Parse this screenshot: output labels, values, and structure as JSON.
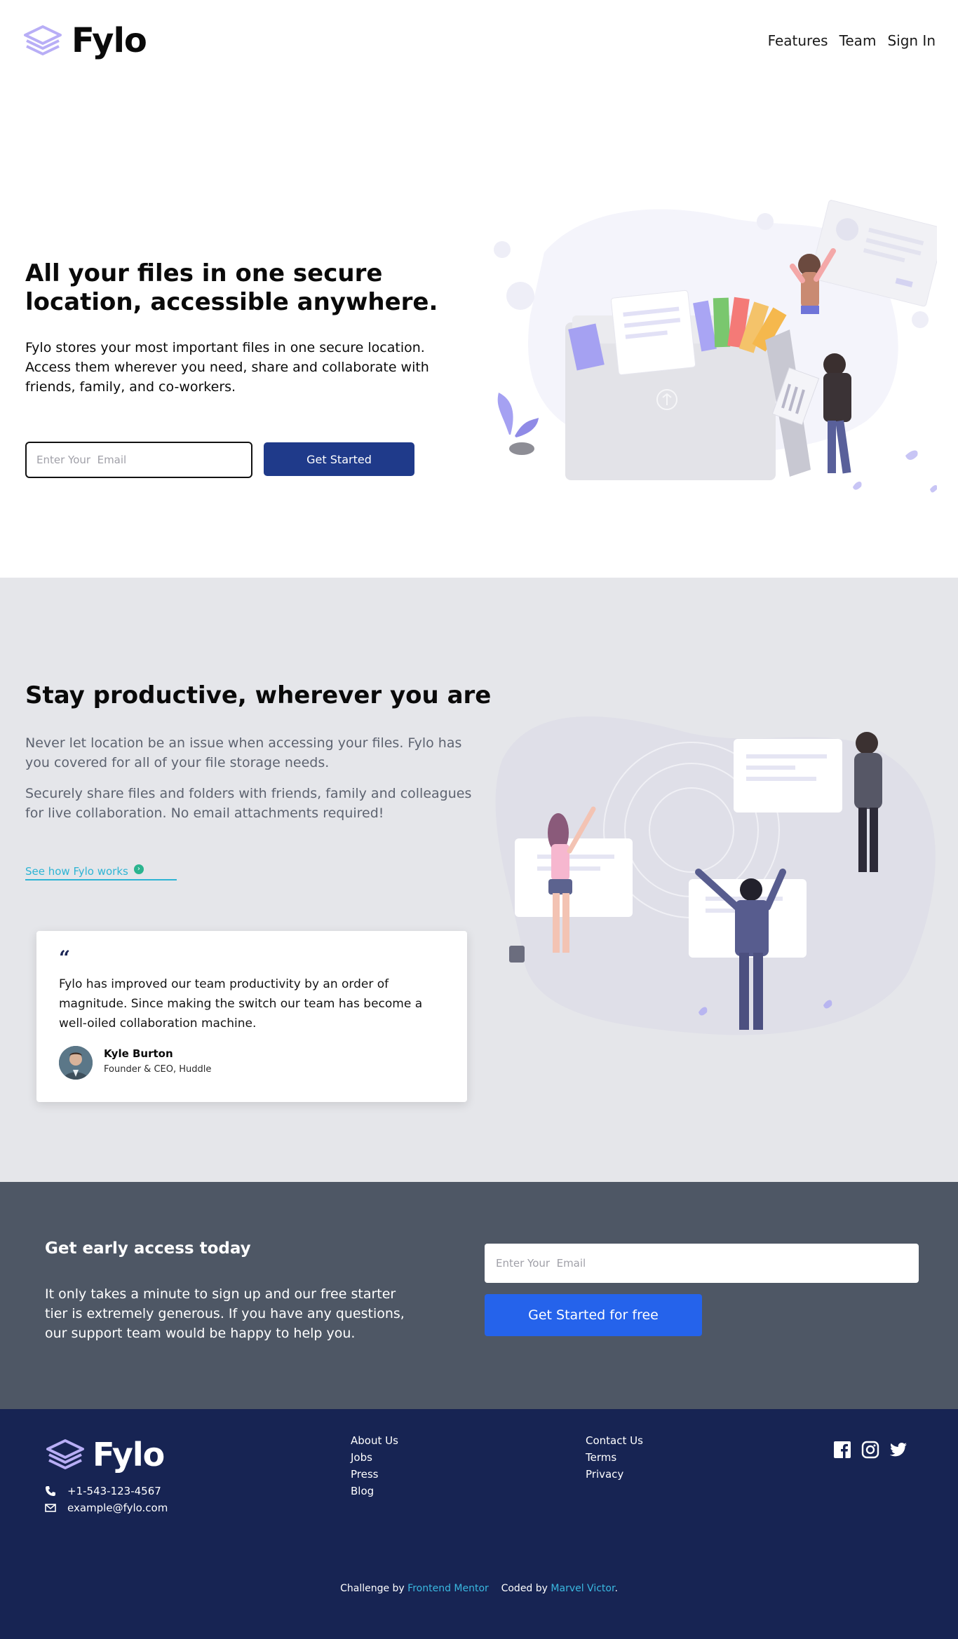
{
  "brand": {
    "name": "Fylo",
    "colors": {
      "primary": "#1f3a8a",
      "accent": "#2563eb",
      "link": "#2eb4d4",
      "footer": "#172453",
      "band": "#4e5765"
    }
  },
  "nav": {
    "items": [
      "Features",
      "Team",
      "Sign In"
    ]
  },
  "hero": {
    "title": "All your files in one secure location, accessible anywhere.",
    "description": "Fylo stores your most important files in one secure location. Access them wherever you need, share and collaborate with friends, family, and co-workers.",
    "email_placeholder": "Enter Your  Email",
    "button_label": "Get Started"
  },
  "productive": {
    "title": "Stay productive, wherever you are",
    "paragraph1": "Never let location be an issue when accessing your files. Fylo has you covered for all of your file storage needs.",
    "paragraph2": "Securely share files and folders with friends, family and colleagues for live collaboration. No email attachments required!",
    "link_label": "See how Fylo works",
    "link_icon": "arrow-circle-icon"
  },
  "testimonial": {
    "quote_mark": "“",
    "quote": "Fylo has improved our team productivity by an order of magnitude. Since making the switch our team has become a well-oiled collaboration machine.",
    "name": "Kyle Burton",
    "role": "Founder & CEO, Huddle"
  },
  "early_access": {
    "title": "Get early access today",
    "description": "It only takes a minute to sign up and our free starter tier is extremely generous. If you have any questions, our support team would be happy to help you.",
    "email_placeholder": "Enter Your  Email",
    "button_label": "Get Started for free"
  },
  "footer": {
    "phone": "+1-543-123-4567",
    "email": "example@fylo.com",
    "col1": [
      "About Us",
      "Jobs",
      "Press",
      "Blog"
    ],
    "col2": [
      "Contact Us",
      "Terms",
      "Privacy"
    ],
    "social": [
      "facebook-icon",
      "instagram-icon",
      "twitter-icon"
    ],
    "credit_prefix": "Challenge by",
    "credit_fm": "Frontend Mentor",
    "credit_mid": "Coded by",
    "credit_author": "Marvel Victor",
    "credit_suffix": "."
  }
}
